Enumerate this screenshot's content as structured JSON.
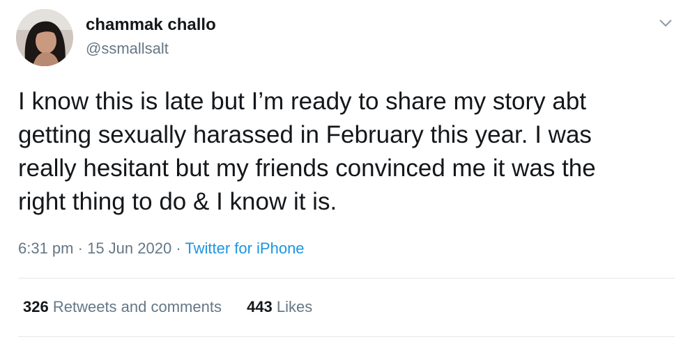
{
  "author": {
    "display_name": "chammak challo",
    "handle": "@ssmallsalt"
  },
  "tweet": {
    "text": "I know this is late but I’m ready to share my story abt\ngetting sexually harassed in February this year. I was\nreally hesitant but my friends convinced me it was the\nright thing to do & I know it is.",
    "time": "6:31 pm",
    "separator_1": "·",
    "date": "15 Jun 2020",
    "separator_2": "·",
    "source": "Twitter for iPhone"
  },
  "stats": {
    "retweets_count": "326",
    "retweets_label": "Retweets and comments",
    "likes_count": "443",
    "likes_label": "Likes"
  },
  "icons": {
    "menu": "chevron-down-icon"
  },
  "colors": {
    "text": "#14171a",
    "secondary": "#657786",
    "link": "#1b95e0",
    "divider": "#e1e8ed"
  }
}
